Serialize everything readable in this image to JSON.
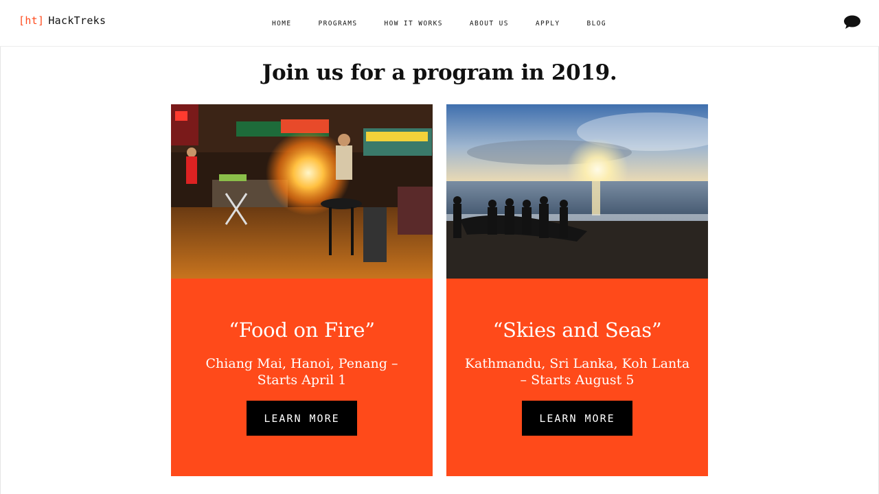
{
  "header": {
    "logo_bracket": "[ht]",
    "logo_name": "HackTreks",
    "nav": [
      "HOME",
      "PROGRAMS",
      "HOW IT WORKS",
      "ABOUT US",
      "APPLY",
      "BLOG"
    ],
    "chat_icon": "chat-bubble-icon"
  },
  "main": {
    "headline": "Join us for a program in 2019.",
    "programs": [
      {
        "image": "night-market-flaming-wok-photo",
        "title": "“Food on Fire”",
        "subtitle": "Chiang Mai, Hanoi, Penang – Starts April 1",
        "button": "LEARN MORE"
      },
      {
        "image": "sunset-beach-fishing-boat-photo",
        "title": "“Skies and Seas”",
        "subtitle": "Kathmandu, Sri Lanka, Koh Lanta – Starts August 5",
        "button": "LEARN MORE"
      }
    ]
  },
  "colors": {
    "accent": "#ff4a1a",
    "button": "#000000",
    "text": "#111111"
  }
}
